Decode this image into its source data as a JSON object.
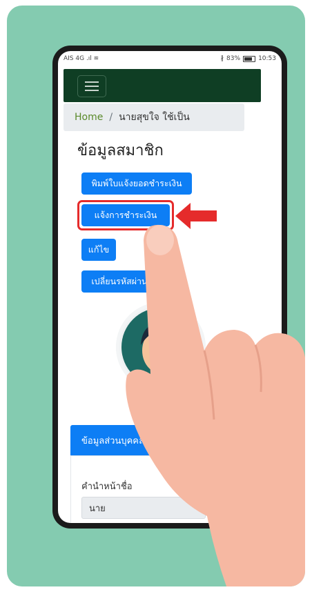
{
  "status_bar": {
    "left": "AIS 4G .ıl ≋",
    "right_bluetooth": "∦",
    "battery": "83%",
    "time": "10:53"
  },
  "breadcrumb": {
    "home": "Home",
    "separator": "/",
    "current": "นายสุขใจ ใช้เป็น"
  },
  "page_title": "ข้อมูลสมาชิก",
  "buttons": {
    "print_invoice": "พิมพ์ใบแจ้งยอดชำระเงิน",
    "notify_payment": "แจ้งการชำระเงิน",
    "edit": "แก้ไข",
    "change_password": "เปลี่ยนรหัสผ่าน"
  },
  "section": {
    "title": "ข้อมูลส่วนบุคคล",
    "prefix_label": "คำนำหน้าชื่อ",
    "prefix_value": "นาย"
  },
  "colors": {
    "background": "#84cbb0",
    "navbar": "#0f3e24",
    "button": "#0d7ef5",
    "highlight": "#e52b2b",
    "hand": "#f6b8a2"
  },
  "icons": [
    "hamburger-menu-icon",
    "battery-icon",
    "red-arrow-left-icon",
    "pointing-hand-illustration",
    "user-avatar-illustration"
  ]
}
